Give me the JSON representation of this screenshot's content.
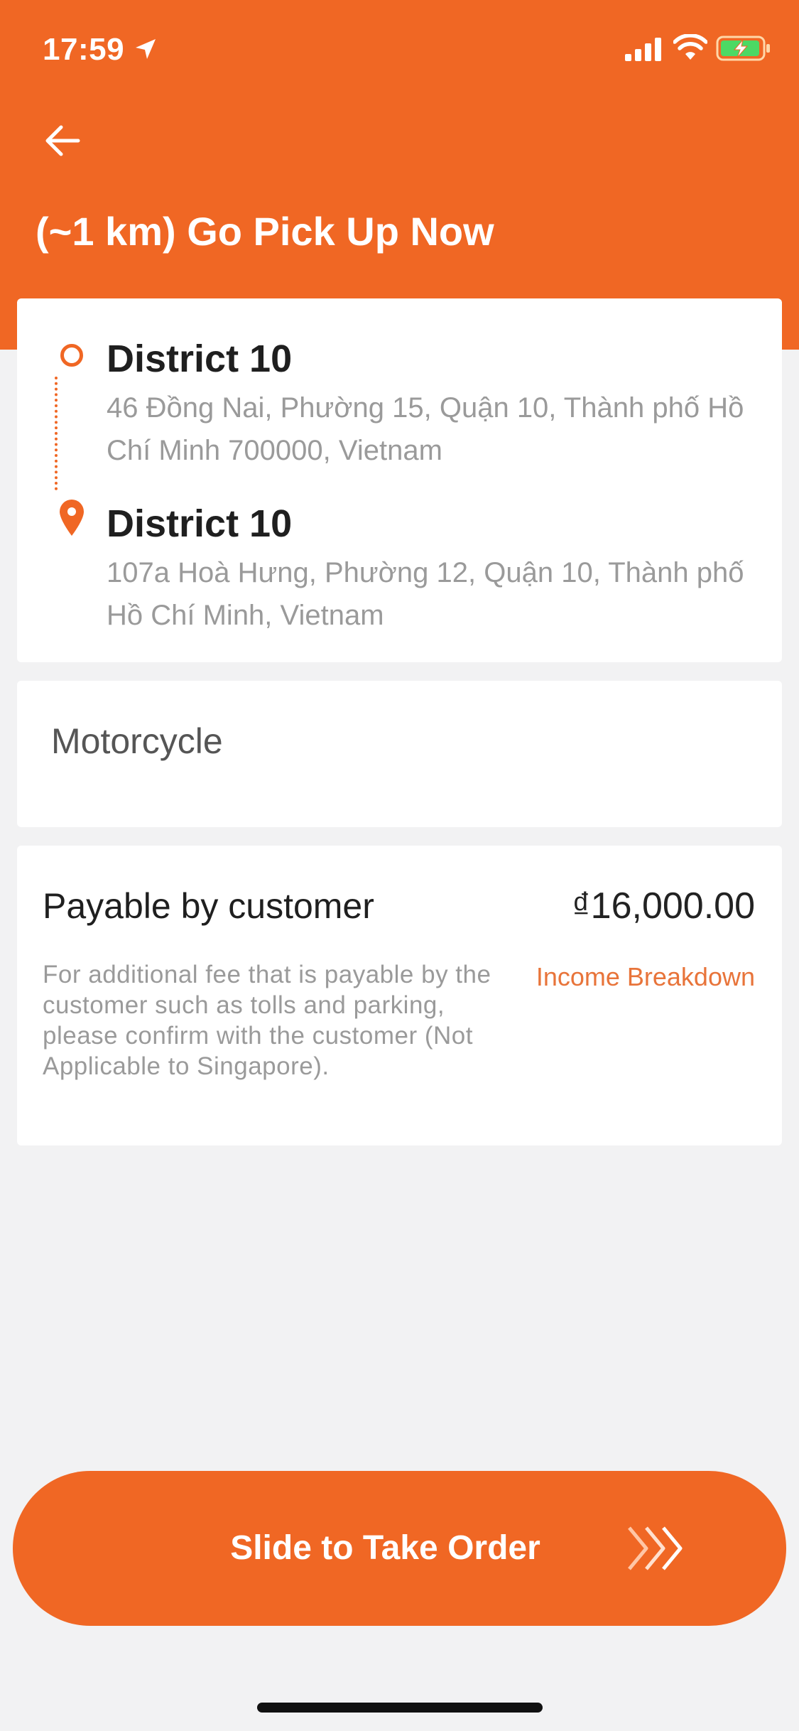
{
  "status_bar": {
    "time": "17:59"
  },
  "header": {
    "title": "(~1 km) Go Pick Up Now"
  },
  "route": {
    "pickup": {
      "name": "District 10",
      "address": "46 Đồng Nai, Phường 15, Quận 10, Thành phố Hồ Chí Minh 700000, Vietnam"
    },
    "dropoff": {
      "name": "District 10",
      "address": "107a Hoà Hưng, Phường 12, Quận 10, Thành phố Hồ Chí Minh, Vietnam"
    }
  },
  "vehicle": {
    "type": "Motorcycle"
  },
  "payment": {
    "label": "Payable by customer",
    "amount": "₫16,000.00",
    "note": "For additional fee that is payable by the customer such as tolls and parking, please confirm with the customer (Not Applicable to Singapore).",
    "breakdown_link": "Income Breakdown"
  },
  "action": {
    "slide_label": "Slide to Take Order"
  },
  "colors": {
    "brand": "#F06724",
    "link": "#E8743A",
    "background": "#F2F2F3"
  },
  "icons": {
    "back": "arrow-left-icon",
    "origin": "origin-circle-icon",
    "destination": "location-pin-icon",
    "slide": "triple-chevron-icon"
  }
}
